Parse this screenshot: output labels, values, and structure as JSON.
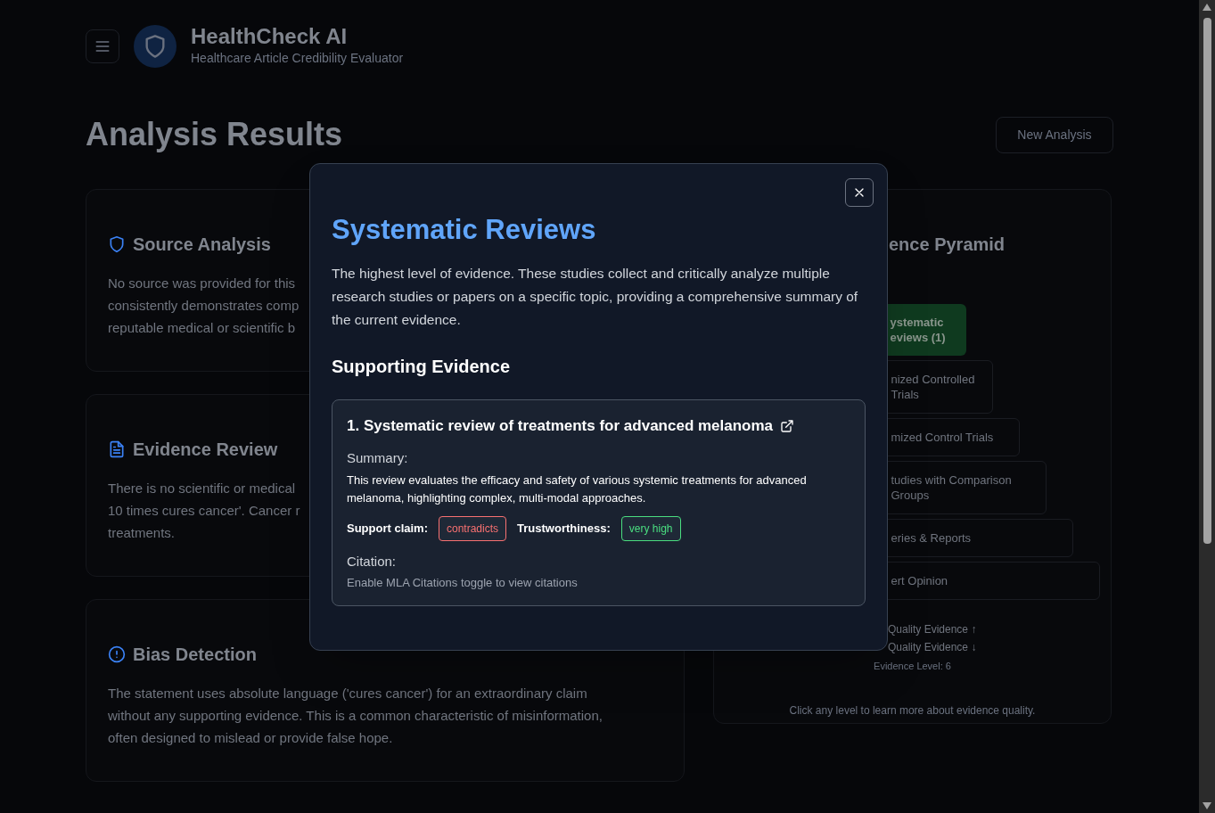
{
  "header": {
    "title": "HealthCheck AI",
    "subtitle": "Healthcare Article Credibility Evaluator"
  },
  "page": {
    "title": "Analysis Results",
    "new_button": "New Analysis"
  },
  "cards": [
    {
      "kind": "shield",
      "title": "Source Analysis",
      "lines": [
        "No source was provided for this",
        "consistently demonstrates comp",
        "reputable medical or scientific b"
      ]
    },
    {
      "kind": "document",
      "title": "Evidence Review",
      "lines": [
        "There is no scientific or medical",
        "10 times cures cancer'. Cancer r",
        "treatments."
      ]
    },
    {
      "kind": "alert",
      "title": "Bias Detection",
      "lines": [
        "The statement uses absolute language ('cures cancer') for an extraordinary claim",
        "without any supporting evidence. This is a common characteristic of misinformation,",
        "often designed to mislead or provide false hope."
      ]
    }
  ],
  "pyramid": {
    "title": "ence Pyramid",
    "levels": [
      {
        "lines": [
          "ystematic",
          "eviews (1)"
        ],
        "selected": true
      },
      {
        "lines": [
          "nized Controlled",
          "Trials"
        ],
        "selected": false
      },
      {
        "lines": [
          "mized Control Trials"
        ],
        "selected": false
      },
      {
        "lines": [
          "tudies with Comparison",
          "Groups"
        ],
        "selected": false
      },
      {
        "lines": [
          "eries & Reports"
        ],
        "selected": false
      },
      {
        "lines": [
          "ert Opinion"
        ],
        "selected": false
      }
    ],
    "legend": [
      "Quality Evidence ↑",
      "Quality Evidence ↓"
    ],
    "level_note": "Evidence Level: 6",
    "hint": "Click any level to learn more about evidence quality."
  },
  "modal": {
    "title": "Systematic Reviews",
    "description": "The highest level of evidence. These studies collect and critically analyze multiple research studies or papers on a specific topic, providing a comprehensive summary of the current evidence.",
    "section": "Supporting Evidence",
    "evidence": [
      {
        "title": "1. Systematic review of treatments for advanced melanoma",
        "summary_label": "Summary:",
        "summary": "This review evaluates the efficacy and safety of various systemic treatments for advanced melanoma, highlighting complex, multi-modal approaches.",
        "ratings": [
          {
            "label": "Support claim:",
            "value": "contradicts",
            "color": "#f87171"
          },
          {
            "label": "Trustworthiness:",
            "value": "very high",
            "color": "#4ade80"
          }
        ],
        "citation_label": "Citation:",
        "citation": "Enable MLA Citations toggle to view citations"
      }
    ]
  }
}
